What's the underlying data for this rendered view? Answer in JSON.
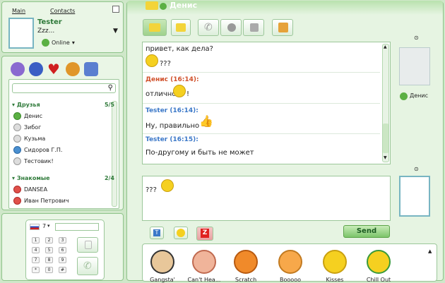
{
  "left_tabs": {
    "main": "Main",
    "contacts": "Contacts"
  },
  "user": {
    "name": "Tester",
    "status_text": "Zzz...",
    "status": "Online"
  },
  "search": {
    "placeholder": ""
  },
  "groups": [
    {
      "name": "Друзья",
      "count": "5/5",
      "contacts": [
        "Денис",
        "Зибог",
        "Кузьма",
        "Сидоров Г.П.",
        "Тестовик!"
      ]
    },
    {
      "name": "Знакомые",
      "count": "2/4",
      "contacts": [
        "DANSEA",
        "Иван Петрович"
      ]
    }
  ],
  "dialer": {
    "line": "7",
    "number": ""
  },
  "keypad": [
    "1",
    "2",
    "3",
    "4",
    "5",
    "6",
    "7",
    "8",
    "9",
    "*",
    "0",
    "#"
  ],
  "chat": {
    "title": "Денис",
    "partner": "Денис",
    "messages": [
      {
        "author": "",
        "text": "привет, как дела?",
        "extra": "???"
      },
      {
        "author": "Денис (16:14):",
        "text": "отлично",
        "extra": "!"
      },
      {
        "author": "Tester (16:14):",
        "text": "Ну, правильно",
        "extra": ""
      },
      {
        "author": "Tester (16:15):",
        "text": "По-другому и быть не может",
        "extra": ""
      }
    ],
    "input": "???",
    "send": "Send"
  },
  "smiles": [
    "Gangsta'",
    "Can't Hea...",
    "Scratch",
    "Booooo",
    "Kisses",
    "Chill Out"
  ],
  "colors": {
    "accent": "#2f8a3a",
    "author_partner": "#d0502a",
    "author_self": "#3b78c8"
  }
}
